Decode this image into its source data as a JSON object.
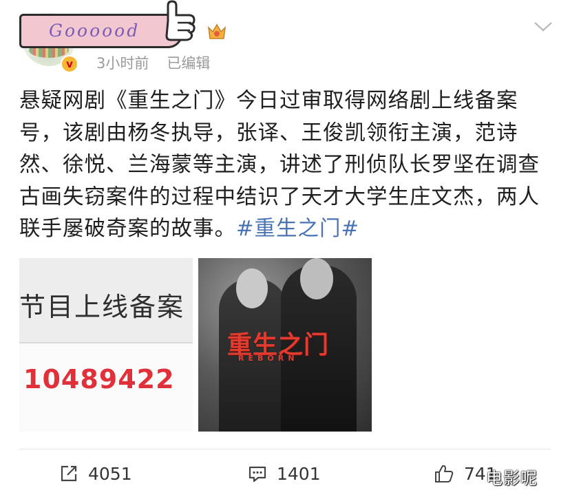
{
  "user": {
    "badge_text": "Goooood",
    "verified_mark": "v",
    "time": "3小时前",
    "edited": "已编辑"
  },
  "post": {
    "body": "悬疑网剧《重生之门》今日过审取得网络剧上线备案号，该剧由杨冬执导，张译、王俊凯领衔主演，范诗然、徐悦、兰海蒙等主演，讲述了刑侦队长罗坚在调查古画失窃案件的过程中结识了天才大学生庄文杰，两人联手屡破奇案的故事。",
    "hashtag": "#重生之门#"
  },
  "images": {
    "image1": {
      "top_text": "节目上线备案",
      "number": "10489422"
    },
    "image2": {
      "title": "重生之门",
      "subtitle": "REBORN"
    }
  },
  "actions": {
    "repost_count": "4051",
    "comment_count": "1401",
    "like_count": "741"
  },
  "watermark": "电影呢",
  "icons": {
    "more": "chevron-down-icon",
    "repost": "repost-icon",
    "comment": "comment-icon",
    "like": "thumbs-up-icon",
    "vip": "crown-icon"
  },
  "colors": {
    "hashtag": "#4a73b4",
    "meta_gray": "#9a9a9a",
    "badge_pink": "#f3c7d0",
    "badge_text": "#7a5bb8",
    "accent_red": "#e0303a"
  }
}
